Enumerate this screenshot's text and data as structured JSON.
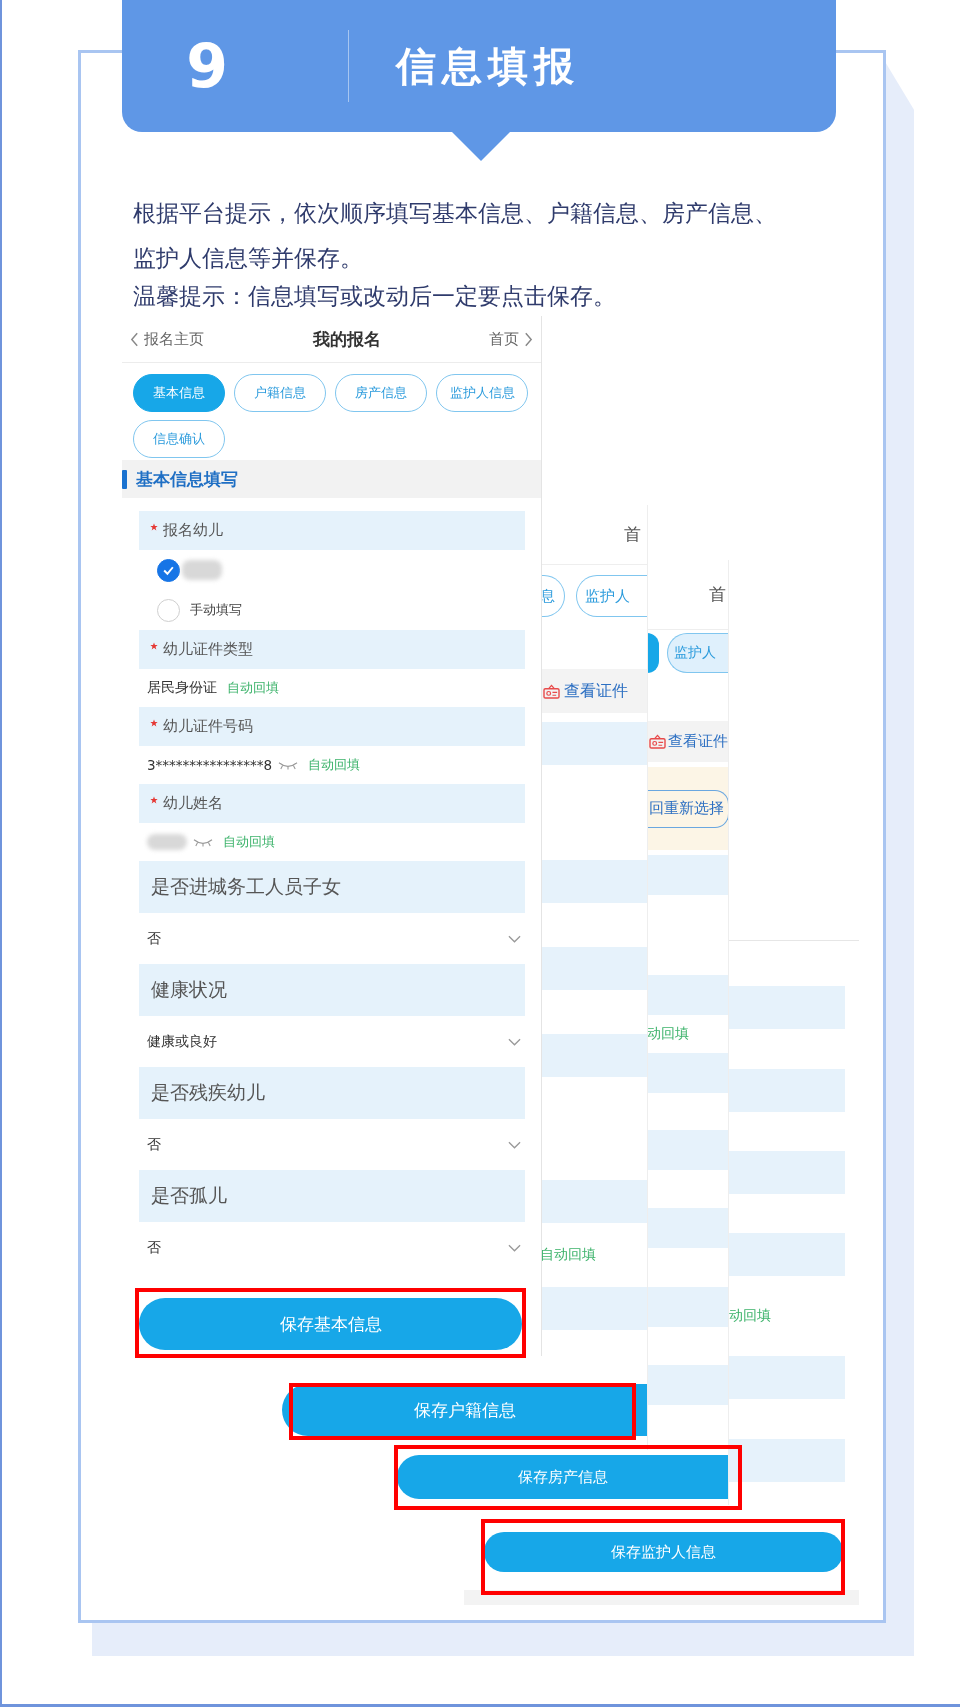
{
  "header": {
    "step": "9",
    "title": "信息填报"
  },
  "instructions": [
    "根据平台提示，依次顺序填写基本信息、户籍信息、房产信息、监护人信息等并保存。",
    "温馨提示：信息填写或改动后一定要点击保存。"
  ],
  "screens": [
    {
      "kind": "basic",
      "nav": {
        "back": "报名主页",
        "title": "我的报名",
        "home": "首页"
      },
      "tabs": [
        {
          "label": "基本信息",
          "selected": true
        },
        {
          "label": "户籍信息",
          "selected": false
        },
        {
          "label": "房产信息",
          "selected": false
        },
        {
          "label": "监护人信息",
          "selected": false
        },
        {
          "label": "信息确认",
          "selected": false
        }
      ],
      "section": "基本信息填写",
      "fields": [
        {
          "kind": "choice",
          "label": "报名幼儿",
          "required": true,
          "options": [
            {
              "redacted": true,
              "selected": true
            },
            {
              "label": "手动填写",
              "selected": false
            }
          ]
        },
        {
          "kind": "text",
          "label": "幼儿证件类型",
          "required": true,
          "value": "居民身份证",
          "autofill": "自动回填"
        },
        {
          "kind": "text",
          "label": "幼儿证件号码",
          "required": true,
          "value": "3****************8",
          "masked": true,
          "autofill": "自动回填"
        },
        {
          "kind": "text",
          "label": "幼儿姓名",
          "required": true,
          "redacted": true,
          "masked": true,
          "autofill": "自动回填"
        },
        {
          "kind": "select",
          "label": "是否进城务工人员子女",
          "value": "否"
        },
        {
          "kind": "select",
          "label": "健康状况",
          "value": "健康或良好"
        },
        {
          "kind": "select",
          "label": "是否残疾幼儿",
          "value": "否"
        },
        {
          "kind": "select",
          "label": "是否孤儿",
          "value": "否"
        }
      ],
      "save_button": {
        "label": "保存基本信息",
        "highlighted": true
      }
    },
    {
      "kind": "household",
      "nav_right": "首",
      "tabs": [
        {
          "label": "息",
          "selected": false
        },
        {
          "label": "监护人",
          "selected": false
        }
      ],
      "id_link": "查看证件",
      "autofill": "自动回填",
      "save_button": {
        "label": "保存户籍信息",
        "highlighted": true
      }
    },
    {
      "kind": "property",
      "nav_right": "首",
      "tabs": [
        {
          "selected": true
        },
        {
          "label": "监护人",
          "selected": false
        }
      ],
      "id_link": "查看证件",
      "reselect_button": "回重新选择",
      "autofill": "动回填",
      "save_button": {
        "label": "保存房产信息",
        "highlighted": true
      }
    },
    {
      "kind": "guardian",
      "autofill": "动回填",
      "save_button": {
        "label": "保存监护人信息",
        "highlighted": true
      }
    }
  ]
}
